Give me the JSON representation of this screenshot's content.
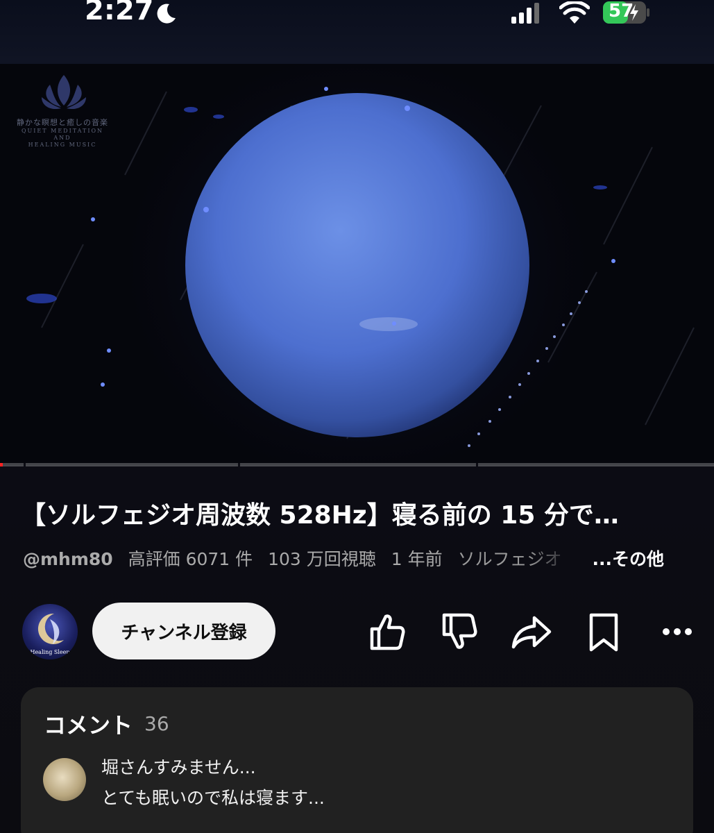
{
  "status_bar": {
    "time": "2:27",
    "battery": "57",
    "focus_icon": "moon-icon",
    "icons": [
      "cellular-signal-icon",
      "wifi-icon",
      "battery-charging-icon"
    ]
  },
  "video": {
    "watermark": {
      "jp": "静かな瞑想と癒しの音楽",
      "en_line1": "QUIET MEDITATION",
      "en_line2": "AND",
      "en_line3": "HEALING MUSIC"
    },
    "progress_fraction": 0.004,
    "chapter_marks": [
      0.033,
      0.333,
      0.667
    ],
    "progress_color": "#ff2222"
  },
  "title": "【ソルフェジオ周波数 528Hz】寝る前の 15 分で…",
  "meta": {
    "handle": "@mhm80",
    "likes": "高評価 6071 件",
    "views": "103 万回視聴",
    "age": "1 年前",
    "description_preview": "ソルフェジオ",
    "more": "...その他"
  },
  "channel": {
    "avatar_text": "Healing Sleep",
    "subscribe_label": "チャンネル登録"
  },
  "actions": [
    "like-icon",
    "dislike-icon",
    "share-icon",
    "save-icon",
    "more-icon"
  ],
  "comments": {
    "title": "コメント",
    "count": "36",
    "top_comment": {
      "line1": "堀さんすみません...",
      "line2": "とても眠いので私は寝ます..."
    }
  }
}
